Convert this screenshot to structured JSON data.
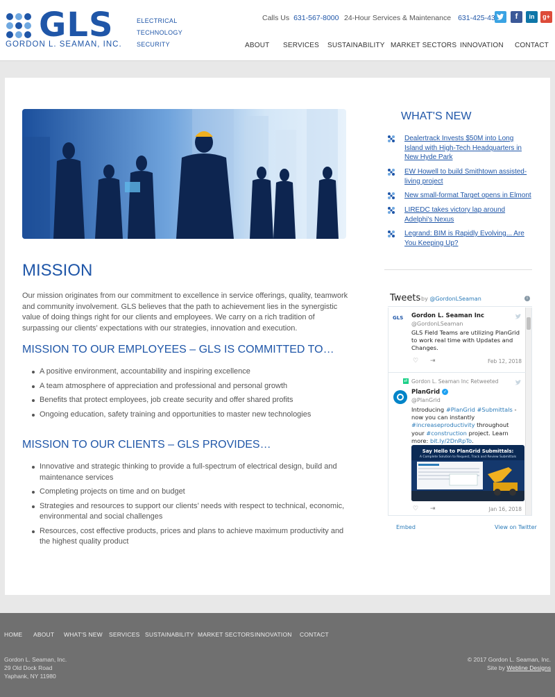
{
  "brand": {
    "logo_text": "GLS",
    "company": "GORDON L. SEAMAN, INC.",
    "tagline": [
      "ELECTRICAL",
      "TECHNOLOGY",
      "SECURITY"
    ],
    "color": "#1f56a8"
  },
  "header": {
    "calls_label": "Calls Us",
    "calls_number": "631-567-8000",
    "service_label": "24-Hour Services & Maintenance",
    "service_number": "631-425-4317",
    "social": [
      "twitter-icon",
      "facebook-icon",
      "linkedin-icon",
      "google-plus-icon"
    ],
    "nav": [
      "ABOUT",
      "SERVICES",
      "SUSTAINABILITY",
      "MARKET SECTORS",
      "INNOVATION",
      "CONTACT"
    ]
  },
  "main": {
    "title": "MISSION",
    "intro": "Our mission originates from our commitment to excellence in service offerings, quality, teamwork and community involvement. GLS believes that the path to achievement lies in the synergistic value of doing things right for our clients and employees. We carry on a rich tradition of surpassing our clients’ expectations with our strategies, innovation and execution.",
    "employees_heading": "MISSION TO OUR EMPLOYEES – GLS IS COMMITTED TO…",
    "employees": [
      "A positive environment, accountability and inspiring excellence",
      "A team atmosphere of appreciation and professional and personal growth",
      "Benefits that protect employees, job create security and offer shared profits",
      "Ongoing education, safety training and opportunities to master new technologies"
    ],
    "clients_heading": "MISSION TO OUR CLIENTS – GLS PROVIDES…",
    "clients": [
      "Innovative and strategic thinking to provide a full-spectrum of electrical design, build and maintenance services",
      "Completing projects on time and on budget",
      "Strategies and resources to support our clients’ needs with respect to technical, economic, environmental and social challenges",
      "Resources, cost effective products, prices and plans to achieve maximum productivity and the highest quality product"
    ]
  },
  "sidebar": {
    "news_title": "WHAT'S NEW",
    "news": [
      "Dealertrack Invests $50M into Long Island with High-Tech Headquarters in New Hyde Park",
      "EW Howell to build Smithtown assisted-living project",
      "New small-format Target opens in Elmont",
      "LIREDC takes victory lap around Adelphi's Nexus",
      "Legrand: BIM is Rapidly Evolving... Are You Keeping Up?"
    ]
  },
  "twitter": {
    "title": "Tweets",
    "by": "by",
    "handle": "@GordonLSeaman",
    "tweets": [
      {
        "name": "Gordon L. Seaman Inc",
        "handle": "@GordonLSeaman",
        "avatar": "GLS",
        "text": "GLS Field Teams are utilizing PlanGrid to work real time with Updates and Changes.",
        "date": "Feb 12, 2018"
      },
      {
        "retweet_label": "Gordon L. Seaman Inc Retweeted",
        "name": "PlanGrid",
        "handle": "@PlanGrid",
        "text_a": "Introducing ",
        "tag1": "#PlanGrid",
        "tag2": "#Submittals",
        "text_b": " - now you can instantly ",
        "tag3": "#increaseproductivity",
        "text_c": " throughout your ",
        "tag4": "#construction",
        "text_d": " project. Learn more: ",
        "link": "bit.ly/2DnRpTo",
        "text_e": ".",
        "card_title": "Say Hello to PlanGrid Submittals:",
        "card_sub": "A Complete Solution to Request, Track and Review Submittals",
        "date": "Jan 16, 2018"
      }
    ],
    "embed": "Embed",
    "view": "View on Twitter"
  },
  "footer": {
    "nav": [
      "HOME",
      "ABOUT",
      "WHAT'S NEW",
      "SERVICES",
      "SUSTAINABILITY",
      "MARKET SECTORS",
      "INNOVATION",
      "CONTACT"
    ],
    "address": [
      "Gordon L. Seaman, Inc.",
      "29 Old Dock Road",
      "Yaphank, NY 11980"
    ],
    "copyright": "© 2017 Gordon L. Seaman, Inc.",
    "site_by": "Site by",
    "designer": "Webline Designs"
  }
}
